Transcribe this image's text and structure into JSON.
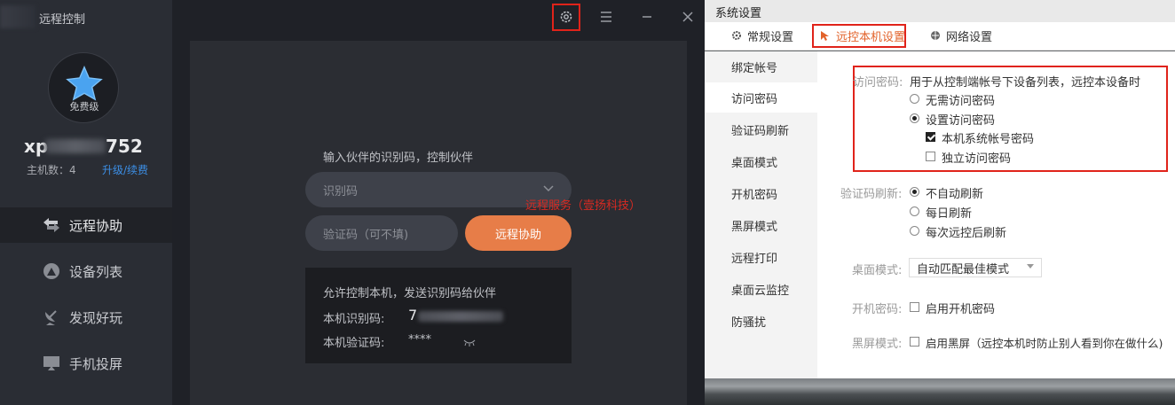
{
  "app": {
    "title": "远程控制",
    "avatar_level": "免费级",
    "username_prefix": "xp",
    "username_suffix": "752",
    "host_count": "主机数：4",
    "upgrade_link": "升级/续费",
    "nav": [
      {
        "label": "远程协助",
        "icon": "swap-arrows-icon"
      },
      {
        "label": "设备列表",
        "icon": "device-list-icon"
      },
      {
        "label": "发现好玩",
        "icon": "satellite-dish-icon"
      },
      {
        "label": "手机投屏",
        "icon": "screen-cast-icon"
      }
    ],
    "topbar": {
      "settings_icon": "gear-icon",
      "menu_icon": "hamburger-menu-icon",
      "minimize_icon": "minimize-icon",
      "close_icon": "close-icon"
    },
    "main": {
      "partner_hint": "输入伙伴的识别码，控制伙伴",
      "id_placeholder": "识别码",
      "code_placeholder": "验证码（可不填)",
      "remote_button": "远程协助",
      "watermark": "远程服务（壹扬科技）",
      "allow_text": "允许控制本机，发送识别码给伙伴",
      "local_id_label": "本机识别码:",
      "local_id_value": "7",
      "local_code_label": "本机验证码:",
      "local_code_value": "****"
    },
    "colors": {
      "accent": "#e77d48",
      "link": "#3c8fe6",
      "highlight": "#e0231a"
    }
  },
  "settings": {
    "title": "系统设置",
    "tabs": [
      {
        "label": "常规设置",
        "icon": "gear-icon"
      },
      {
        "label": "远控本机设置",
        "icon": "remote-control-icon"
      },
      {
        "label": "网络设置",
        "icon": "network-icon"
      }
    ],
    "left_nav": [
      "绑定帐号",
      "访问密码",
      "验证码刷新",
      "桌面模式",
      "开机密码",
      "黑屏模式",
      "远程打印",
      "桌面云监控",
      "防骚扰"
    ],
    "access_password": {
      "label": "访问密码:",
      "desc": "用于从控制端帐号下设备列表，远控本设备时",
      "opt_none": "无需访问密码",
      "opt_set": "设置访问密码",
      "chk_system": "本机系统帐号密码",
      "chk_independent": "独立访问密码"
    },
    "code_refresh": {
      "label": "验证码刷新:",
      "opt_none": "不自动刷新",
      "opt_daily": "每日刷新",
      "opt_each": "每次远控后刷新"
    },
    "desktop_mode": {
      "label": "桌面模式:",
      "value": "自动匹配最佳模式"
    },
    "boot_password": {
      "label": "开机密码:",
      "chk": "启用开机密码"
    },
    "black_screen": {
      "label": "黑屏模式:",
      "chk": "启用黑屏（远控本机时防止别人看到你在做什么)"
    }
  }
}
